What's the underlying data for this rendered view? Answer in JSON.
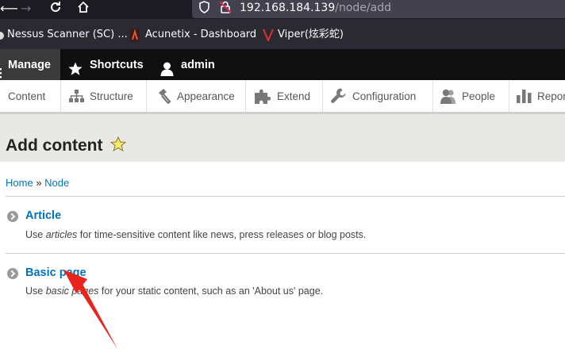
{
  "browser": {
    "url_host": "192.168.184.139",
    "url_path": "/node/add",
    "bookmarks": [
      {
        "label": "Nessus Scanner (SC) ..."
      },
      {
        "label": "Acunetix - Dashboard"
      },
      {
        "label": "Viper(炫彩蛇)"
      }
    ]
  },
  "toolbar": {
    "manage": "Manage",
    "shortcuts": "Shortcuts",
    "user": "admin"
  },
  "tray": [
    {
      "label": "Content"
    },
    {
      "label": "Structure"
    },
    {
      "label": "Appearance"
    },
    {
      "label": "Extend"
    },
    {
      "label": "Configuration"
    },
    {
      "label": "People"
    },
    {
      "label": "Repor"
    }
  ],
  "page": {
    "title": "Add content",
    "breadcrumb": {
      "home": "Home",
      "sep": "»",
      "current": "Node"
    }
  },
  "content_types": [
    {
      "title": "Article",
      "desc_pre": "Use ",
      "desc_em": "articles",
      "desc_post": " for time-sensitive content like news, press releases or blog posts."
    },
    {
      "title": "Basic page",
      "desc_pre": "Use ",
      "desc_em": "basic pages",
      "desc_post": " for your static content, such as an 'About us' page."
    }
  ],
  "colors": {
    "link": "#0074bd",
    "toolbar_bg": "#0f0f0f",
    "annotation_arrow": "#e8241c"
  }
}
